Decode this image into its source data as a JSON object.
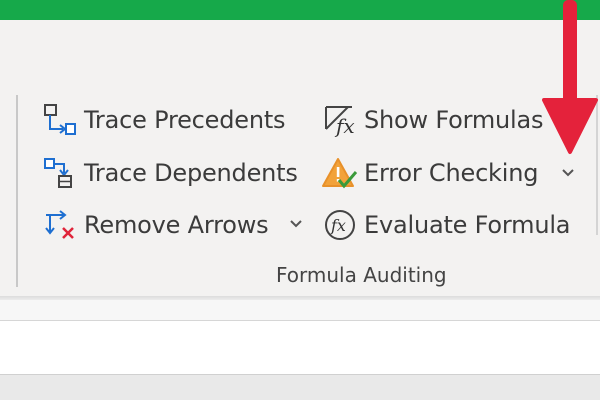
{
  "ribbon": {
    "group_label": "Formula Auditing",
    "commands": {
      "trace_precedents": "Trace Precedents",
      "trace_dependents": "Trace Dependents",
      "remove_arrows": "Remove Arrows",
      "show_formulas": "Show Formulas",
      "error_checking": "Error Checking",
      "evaluate_formula": "Evaluate Formula"
    },
    "icons": {
      "trace_precedents": "trace-precedents-icon",
      "trace_dependents": "trace-dependents-icon",
      "remove_arrows": "remove-arrows-icon",
      "show_formulas": "show-formulas-icon",
      "error_checking": "error-checking-icon",
      "evaluate_formula": "evaluate-formula-icon"
    }
  },
  "colors": {
    "title_bar": "#16a94a",
    "ribbon_bg": "#f3f2f1",
    "label_text": "#3b3b3b",
    "icon_blue": "#1e6fd1",
    "icon_red": "#e0243a",
    "icon_orange": "#e8912a",
    "icon_green": "#3a9a3a",
    "annotation_arrow": "#e4223b"
  }
}
